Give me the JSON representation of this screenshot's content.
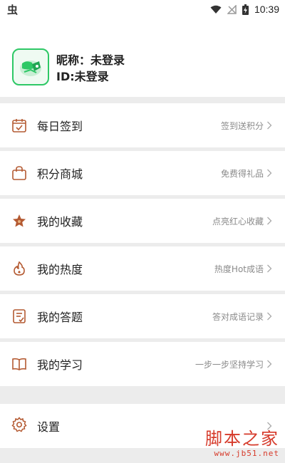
{
  "status_bar": {
    "left_glyph": "虫",
    "time": "10:39"
  },
  "profile": {
    "nickname": "昵称：未登录",
    "id": "ID:未登录"
  },
  "menu": [
    {
      "label": "每日签到",
      "hint": "签到送积分",
      "icon": "calendar-check-icon"
    },
    {
      "label": "积分商城",
      "hint": "免费得礼品",
      "icon": "shopping-bag-icon"
    },
    {
      "label": "我的收藏",
      "hint": "点亮红心收藏",
      "icon": "star-icon"
    },
    {
      "label": "我的热度",
      "hint": "热度Hot成语",
      "icon": "flame-icon"
    },
    {
      "label": "我的答题",
      "hint": "答对成语记录",
      "icon": "notebook-icon"
    },
    {
      "label": "我的学习",
      "hint": "一步一步坚持学习",
      "icon": "open-book-icon"
    }
  ],
  "settings": {
    "label": "设置",
    "icon": "gear-icon"
  },
  "watermark": {
    "main": "脚本之家",
    "url": "www.jb51.net"
  },
  "colors": {
    "icon_accent": "#b45a32",
    "avatar_border": "#2ec866",
    "hint_text": "#8a8a8a",
    "watermark": "#d63a2a"
  }
}
